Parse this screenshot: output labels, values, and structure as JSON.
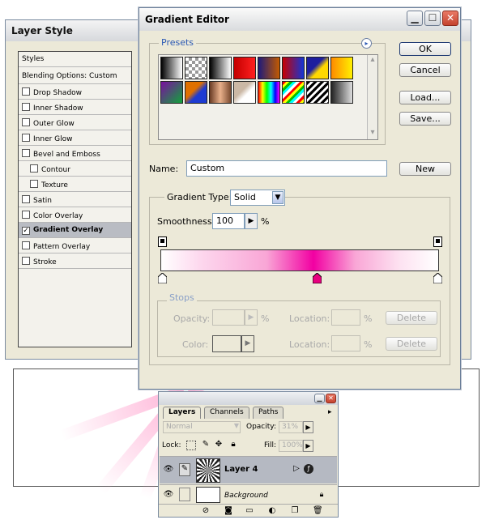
{
  "layer_style": {
    "title": "Layer Style",
    "styles_header": "Styles",
    "blending_options": "Blending Options: Custom",
    "effects": [
      {
        "label": "Drop Shadow",
        "checked": false,
        "indent": false
      },
      {
        "label": "Inner Shadow",
        "checked": false,
        "indent": false
      },
      {
        "label": "Outer Glow",
        "checked": false,
        "indent": false
      },
      {
        "label": "Inner Glow",
        "checked": false,
        "indent": false
      },
      {
        "label": "Bevel and Emboss",
        "checked": false,
        "indent": false
      },
      {
        "label": "Contour",
        "checked": false,
        "indent": true
      },
      {
        "label": "Texture",
        "checked": false,
        "indent": true
      },
      {
        "label": "Satin",
        "checked": false,
        "indent": false
      },
      {
        "label": "Color Overlay",
        "checked": false,
        "indent": false
      },
      {
        "label": "Gradient Overlay",
        "checked": true,
        "indent": false,
        "selected": true
      },
      {
        "label": "Pattern Overlay",
        "checked": false,
        "indent": false
      },
      {
        "label": "Stroke",
        "checked": false,
        "indent": false
      }
    ]
  },
  "gradient_editor": {
    "title": "Gradient Editor",
    "presets_label": "Presets",
    "buttons": {
      "ok": "OK",
      "cancel": "Cancel",
      "load": "Load...",
      "save": "Save...",
      "new": "New"
    },
    "name_label": "Name:",
    "name_value": "Custom",
    "gradient_type_label": "Gradient Type:",
    "gradient_type_value": "Solid",
    "smoothness_label": "Smoothness:",
    "smoothness_value": "100",
    "smoothness_unit": "%",
    "stops_label": "Stops",
    "opacity_label": "Opacity:",
    "opacity_unit": "%",
    "color_label": "Color:",
    "location_label": "Location:",
    "location_unit": "%",
    "delete_label": "Delete",
    "gradient_colors": [
      "#ffffff",
      "#f200a2",
      "#ffffff"
    ],
    "color_midpoint_stop": "#e8007f",
    "preset_gradients": [
      "linear-gradient(90deg,#000,#fff)",
      "repeating-conic-gradient(#999 0 25%,#fff 0 50%) 0 0/8px 8px",
      "linear-gradient(90deg,#000,#fff)",
      "linear-gradient(90deg,#c40000,#ff2020)",
      "linear-gradient(90deg,#1e1a7a,#c25a00)",
      "linear-gradient(90deg,#c80000,#1436d6)",
      "linear-gradient(135deg,#1e1e9e 40%,#ffd800 60%)",
      "linear-gradient(90deg,#ff8a00,#fff000)",
      "linear-gradient(135deg,#7a0ea0,#11a33a)",
      "linear-gradient(135deg,#e07000 40%,#1d3bd2 60%)",
      "linear-gradient(90deg,#6a3b24,#e9b08b,#7a4a30)",
      "linear-gradient(135deg,#cbb8a5 40%,#ffffff 60%)",
      "linear-gradient(90deg,#ff0000,#ff0 20%,#0f0 40%,#0ff 60%,#00f 80%,#f0f)",
      "repeating-linear-gradient(135deg,#ff0000 0 3px,#ffff00 3px 6px,#00c000 6px 9px,#00ffff 9px 12px,#ffffff 12px 15px)",
      "repeating-linear-gradient(135deg,#000 0 3px,#fff 3px 6px)",
      "linear-gradient(90deg,#222,#ddd)"
    ]
  },
  "layers_panel": {
    "tabs": [
      "Layers",
      "Channels",
      "Paths"
    ],
    "blend_mode": "Normal",
    "opacity_label": "Opacity:",
    "opacity_value": "31%",
    "lock_label": "Lock:",
    "fill_label": "Fill:",
    "fill_value": "100%",
    "layers": [
      {
        "name": "Layer 4",
        "selected": true
      },
      {
        "name": "Background",
        "selected": false
      }
    ]
  }
}
